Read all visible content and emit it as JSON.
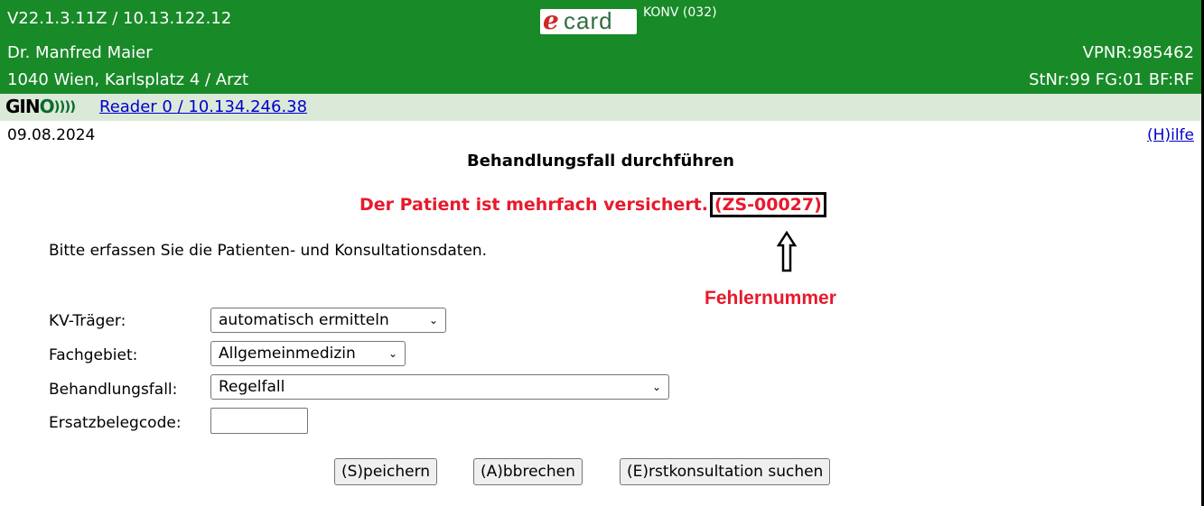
{
  "header": {
    "version_ip": "V22.1.3.11Z / 10.13.122.12",
    "logo_e": "e",
    "logo_card": "card",
    "konv": "KONV (032)",
    "doctor": "Dr. Manfred Maier",
    "vpnr": "VPNR:985462",
    "address": "1040 Wien, Karlsplatz 4 / Arzt",
    "station": "StNr:99 FG:01 BF:RF",
    "brand_color": "#188a28"
  },
  "reader": {
    "logo_gin": "GIN",
    "logo_o": "O",
    "logo_waves": "))))",
    "link": "Reader 0 / 10.134.246.38"
  },
  "datebar": {
    "date": "09.08.2024",
    "help": "(H)ilfe"
  },
  "main": {
    "title": "Behandlungsfall durchführen",
    "error_text": "Der Patient ist mehrfach versichert.",
    "error_code": "(ZS-00027)",
    "annotation_label": "Fehlernummer",
    "instruction": "Bitte erfassen Sie die Patienten- und Konsultationsdaten."
  },
  "form": {
    "kv_label": "KV-Träger:",
    "kv_value": "automatisch ermitteln",
    "fach_label": "Fachgebiet:",
    "fach_value": "Allgemeinmedizin",
    "fall_label": "Behandlungsfall:",
    "fall_value": "Regelfall",
    "ersatz_label": "Ersatzbelegcode:",
    "ersatz_value": ""
  },
  "buttons": {
    "save": "(S)peichern",
    "cancel": "(A)bbrechen",
    "search": "(E)rstkonsultation suchen"
  }
}
